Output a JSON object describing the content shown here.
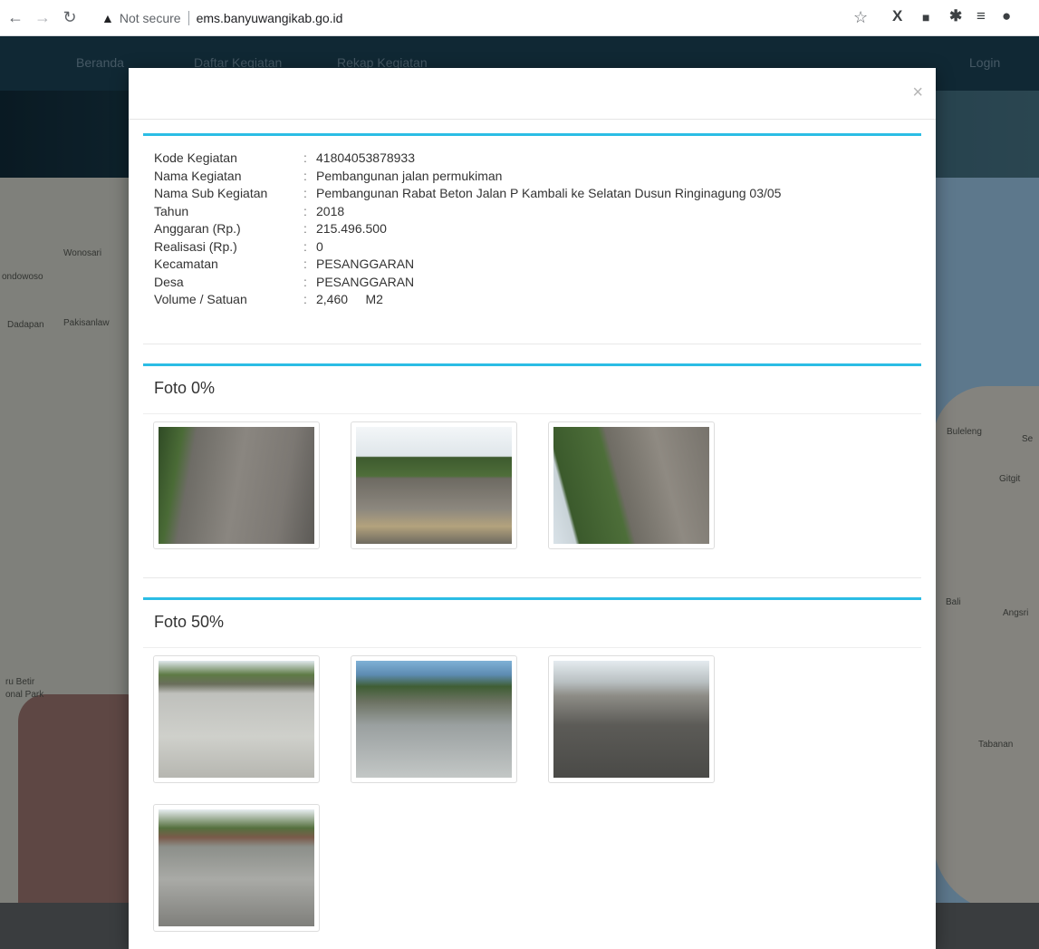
{
  "browser": {
    "security_label": "Not secure",
    "url": "ems.banyuwangikab.go.id"
  },
  "site_nav": {
    "home": "Beranda",
    "list": "Daftar Kegiatan",
    "recap": "Rekap Kegiatan",
    "login": "Login"
  },
  "map_labels": [
    "Wonosari",
    "ondowoso",
    "Dadapan",
    "Pakisanlaw",
    "Buleleng",
    "Gitgit",
    "Bali",
    "Angsri",
    "ru Betir",
    "onal Park",
    "Tabanan",
    "Se"
  ],
  "modal": {
    "close": "×",
    "info": [
      {
        "label": "Kode Kegiatan",
        "value": "41804053878933"
      },
      {
        "label": "Nama Kegiatan",
        "value": "Pembangunan jalan permukiman"
      },
      {
        "label": "Nama Sub Kegiatan",
        "value": "Pembangunan Rabat Beton Jalan P Kambali ke Selatan Dusun Ringinagung 03/05"
      },
      {
        "label": "Tahun",
        "value": "2018"
      },
      {
        "label": "Anggaran (Rp.)",
        "value": "215.496.500"
      },
      {
        "label": "Realisasi (Rp.)",
        "value": "0"
      },
      {
        "label": "Kecamatan",
        "value": "PESANGGARAN"
      },
      {
        "label": "Desa",
        "value": "PESANGGARAN"
      },
      {
        "label": "Volume / Satuan",
        "value": "2,460     M2"
      }
    ],
    "colon": ":",
    "foto0_title": "Foto 0%",
    "foto50_title": "Foto 50%"
  }
}
